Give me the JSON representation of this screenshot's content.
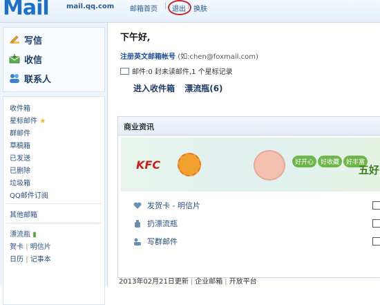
{
  "header": {
    "logo": "Mail",
    "domain": "mail.qq.com",
    "nav": [
      "邮箱首页",
      "退出",
      "换肤"
    ],
    "nav_sep": "|"
  },
  "sidebar": {
    "quick": [
      {
        "label": "写信",
        "icon": "pencil-icon"
      },
      {
        "label": "收信",
        "icon": "inbox-icon"
      },
      {
        "label": "联系人",
        "icon": "contacts-icon"
      }
    ],
    "folders": [
      "收件箱",
      "星标邮件",
      "群邮件",
      "草稿箱",
      "已发送",
      "已删除",
      "垃圾箱",
      "QQ邮件订阅"
    ],
    "other": "其他邮箱",
    "apps": [
      "漂流瓶",
      "贺卡",
      "明信片",
      "日历",
      "记事本"
    ]
  },
  "main": {
    "greeting": "下午好,",
    "register_link": "注册英文邮箱帐号",
    "register_hint": "(如:chen@foxmail.com)",
    "mail_stats": "邮件:0 封未读邮件,1 个星标记录",
    "inbox_link": "进入收件箱",
    "drift_link": "漂流瓶(6)",
    "box_title": "商业资讯",
    "banner": {
      "brand": "KFC",
      "badges": [
        "好开心",
        "好收藏",
        "好丰富"
      ],
      "slogan": "五好"
    },
    "services": [
      {
        "label": "发贺卡 - 明信片",
        "icon": "heart-icon"
      },
      {
        "label": "扔漂流瓶",
        "icon": "bottle-icon"
      },
      {
        "label": "写群邮件",
        "icon": "group-mail-icon"
      }
    ],
    "footer": {
      "updated": "2013年02月21日更新",
      "enterprise": "企业邮箱",
      "platform": "开放平台",
      "sep": "|"
    }
  },
  "colors": {
    "accent": "#1f6fc5",
    "link": "#2a4f80",
    "highlight_circle": "#c0282d"
  }
}
